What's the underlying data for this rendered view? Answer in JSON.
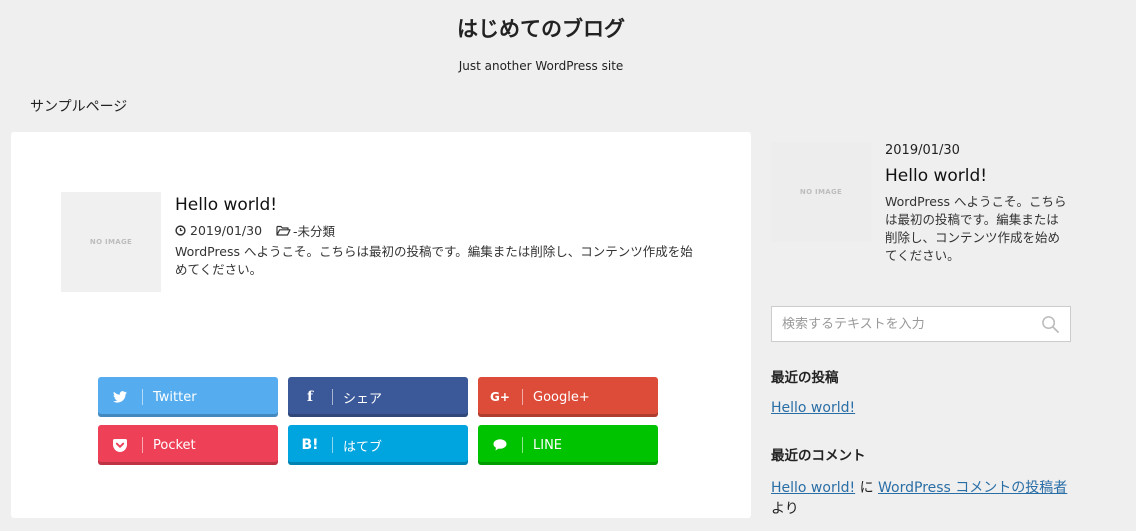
{
  "header": {
    "site_title": "はじめてのブログ",
    "site_description": "Just another WordPress site"
  },
  "nav": {
    "items": [
      {
        "label": "サンプルページ"
      }
    ]
  },
  "main": {
    "post": {
      "thumbnail_text": "NO IMAGE",
      "title": "Hello world!",
      "date": "2019/01/30",
      "category": "-未分類",
      "excerpt": "WordPress へようこそ。こちらは最初の投稿です。編集または削除し、コンテンツ作成を始めてください。"
    },
    "share_buttons": [
      {
        "name": "twitter",
        "label": "Twitter",
        "icon": "twitter-bird-icon",
        "color": "#55acee"
      },
      {
        "name": "facebook",
        "label": "シェア",
        "icon": "f",
        "color": "#3b5998"
      },
      {
        "name": "googleplus",
        "label": "Google+",
        "icon": "G+",
        "color": "#dd4b39"
      },
      {
        "name": "pocket",
        "label": "Pocket",
        "icon": "pocket-icon",
        "color": "#ee4056"
      },
      {
        "name": "hatena",
        "label": "はてブ",
        "icon": "B!",
        "color": "#00a4de"
      },
      {
        "name": "line",
        "label": "LINE",
        "icon": "speech-bubble-icon",
        "color": "#00c300"
      }
    ]
  },
  "sidebar": {
    "featured": {
      "thumbnail_text": "NO IMAGE",
      "date": "2019/01/30",
      "title": "Hello world!",
      "excerpt": "WordPress へようこそ。こちらは最初の投稿です。編集または削除し、コンテンツ作成を始めてください。"
    },
    "search": {
      "placeholder": "検索するテキストを入力"
    },
    "recent_posts": {
      "heading": "最近の投稿",
      "items": [
        "Hello world!"
      ]
    },
    "recent_comments": {
      "heading": "最近のコメント",
      "post_link": "Hello world!",
      "connector": "に",
      "author_link": "WordPress コメントの投稿者",
      "suffix": "より"
    }
  }
}
